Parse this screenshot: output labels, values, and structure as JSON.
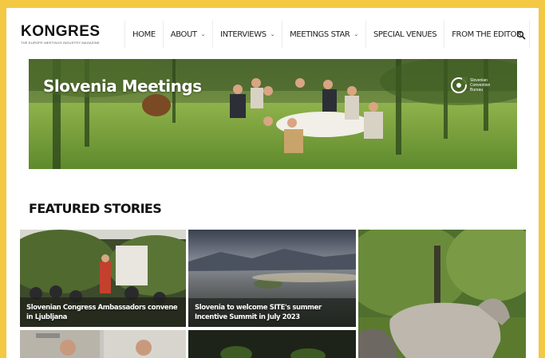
{
  "brand": {
    "name": "KONGRES",
    "tagline": "THE EUROPE MEETINGS INDUSTRY MAGAZINE"
  },
  "nav": {
    "items": [
      {
        "label": "HOME",
        "has_dropdown": false
      },
      {
        "label": "ABOUT",
        "has_dropdown": true
      },
      {
        "label": "INTERVIEWS",
        "has_dropdown": true
      },
      {
        "label": "MEETINGS STAR",
        "has_dropdown": true
      },
      {
        "label": "SPECIAL VENUES",
        "has_dropdown": false
      },
      {
        "label": "FROM THE EDITOR",
        "has_dropdown": false
      }
    ],
    "search_icon": "search-icon"
  },
  "hero": {
    "title": "Slovenia Meetings",
    "partner_logo_text": "Slovenian Convention Bureau"
  },
  "featured": {
    "heading": "FEATURED STORIES",
    "stories": [
      {
        "caption": "Slovenian Congress Ambassadors convene in Ljubljana"
      },
      {
        "caption": "Slovenia to welcome SITE's summer Incentive Summit in July 2023"
      },
      {
        "caption": ""
      },
      {
        "caption": ""
      },
      {
        "caption": ""
      }
    ]
  },
  "colors": {
    "frame": "#f3c843",
    "page_bg": "#ffffff",
    "text": "#111111"
  }
}
